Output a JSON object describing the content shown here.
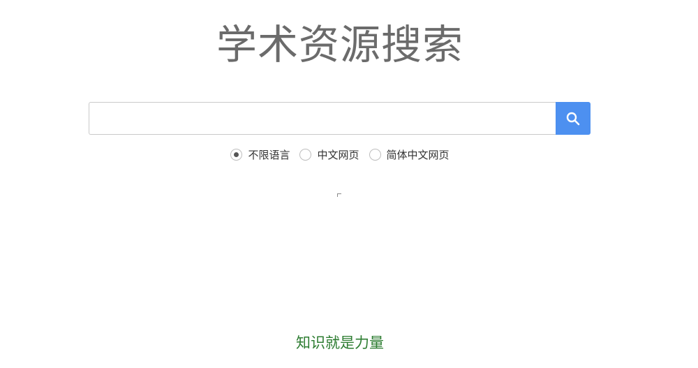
{
  "header": {
    "title": "学术资源搜索"
  },
  "search": {
    "value": "",
    "placeholder": "",
    "button_icon": "search-icon"
  },
  "language_options": [
    {
      "label": "不限语言",
      "checked": true
    },
    {
      "label": "中文网页",
      "checked": false
    },
    {
      "label": "简体中文网页",
      "checked": false
    }
  ],
  "footer": {
    "slogan": "知识就是力量"
  },
  "colors": {
    "title": "#6b6b6b",
    "search_button": "#4d90f0",
    "slogan": "#2e7d32"
  }
}
